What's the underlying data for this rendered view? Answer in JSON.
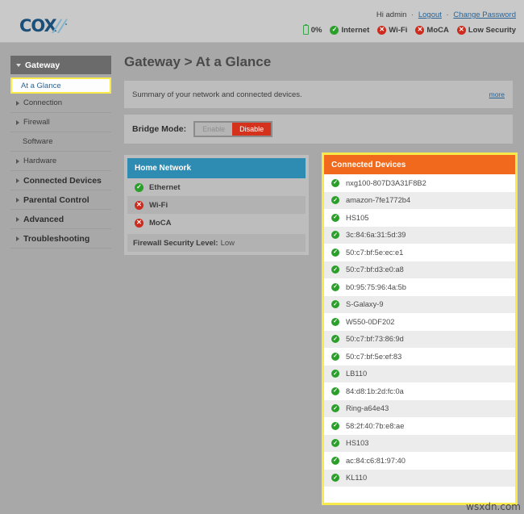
{
  "brand": {
    "name": "COX",
    "accent_blue": "#1a4f7a"
  },
  "header": {
    "greeting": "Hi admin",
    "logout_label": "Logout",
    "change_password_label": "Change Password",
    "separator": "·",
    "battery_percent": "0%",
    "status_items": [
      {
        "label": "Internet",
        "state": "ok"
      },
      {
        "label": "Wi-Fi",
        "state": "bad"
      },
      {
        "label": "MoCA",
        "state": "bad"
      },
      {
        "label": "Low Security",
        "state": "bad"
      }
    ]
  },
  "sidebar": {
    "section_label": "Gateway",
    "selected_label": "At a Glance",
    "items": [
      {
        "label": "Connection",
        "level": "sub",
        "caret": true
      },
      {
        "label": "Firewall",
        "level": "sub",
        "caret": true
      },
      {
        "label": "Software",
        "level": "sub",
        "caret": false
      },
      {
        "label": "Hardware",
        "level": "sub",
        "caret": true
      },
      {
        "label": "Connected Devices",
        "level": "top",
        "caret": true
      },
      {
        "label": "Parental Control",
        "level": "top",
        "caret": true
      },
      {
        "label": "Advanced",
        "level": "top",
        "caret": true
      },
      {
        "label": "Troubleshooting",
        "level": "top",
        "caret": true
      }
    ]
  },
  "main": {
    "page_title": "Gateway > At a Glance",
    "summary_text": "Summary of your network and connected devices.",
    "more_label": "more",
    "bridge_mode_label": "Bridge Mode:",
    "bridge_enable_label": "Enable",
    "bridge_disable_label": "Disable",
    "bridge_active": "Disable"
  },
  "home_network": {
    "title": "Home Network",
    "rows": [
      {
        "label": "Ethernet",
        "state": "ok"
      },
      {
        "label": "Wi-Fi",
        "state": "bad"
      },
      {
        "label": "MoCA",
        "state": "bad"
      }
    ],
    "firewall_label": "Firewall Security Level:",
    "firewall_value": "Low"
  },
  "connected_devices": {
    "title": "Connected Devices",
    "devices": [
      {
        "name": "nxg100-807D3A31F8B2",
        "state": "ok"
      },
      {
        "name": "amazon-7fe1772b4",
        "state": "ok"
      },
      {
        "name": "HS105",
        "state": "ok"
      },
      {
        "name": "3c:84:6a:31:5d:39",
        "state": "ok"
      },
      {
        "name": "50:c7:bf:5e:ec:e1",
        "state": "ok"
      },
      {
        "name": "50:c7:bf:d3:e0:a8",
        "state": "ok"
      },
      {
        "name": "b0:95:75:96:4a:5b",
        "state": "ok"
      },
      {
        "name": "S-Galaxy-9",
        "state": "ok"
      },
      {
        "name": "W550-0DF202",
        "state": "ok"
      },
      {
        "name": "50:c7:bf:73:86:9d",
        "state": "ok"
      },
      {
        "name": "50:c7:bf:5e:ef:83",
        "state": "ok"
      },
      {
        "name": "LB110",
        "state": "ok"
      },
      {
        "name": "84:d8:1b:2d:fc:0a",
        "state": "ok"
      },
      {
        "name": "Ring-a64e43",
        "state": "ok"
      },
      {
        "name": "58:2f:40:7b:e8:ae",
        "state": "ok"
      },
      {
        "name": "HS103",
        "state": "ok"
      },
      {
        "name": "ac:84:c6:81:97:40",
        "state": "ok"
      },
      {
        "name": "KL110",
        "state": "ok"
      }
    ]
  },
  "watermark": {
    "text": "wsxdn.com"
  }
}
